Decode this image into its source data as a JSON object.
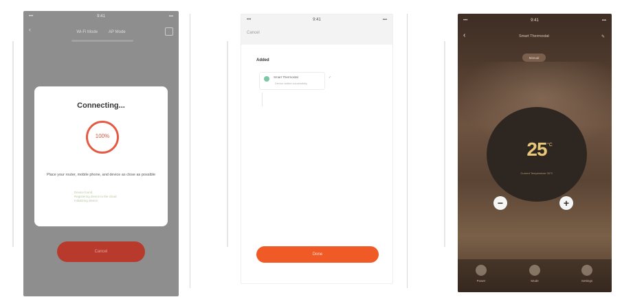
{
  "screen1": {
    "status_left": "•••",
    "status_center": "9:41",
    "status_right": "▪▪▪",
    "header_left": "Wi-Fi Mode",
    "header_right": "AP Mode",
    "back_glyph": "‹",
    "modal_title": "Connecting...",
    "progress_text": "100%",
    "progress_value": 1.0,
    "hint": "Place your router, mobile phone, and device as close as possible",
    "steps": [
      "Device found",
      "Registering device to the cloud",
      "Initializing device"
    ],
    "cancel_label": "Cancel",
    "accent_color": "#e35a45"
  },
  "screen2": {
    "status_left": "•••",
    "status_center": "9:41",
    "status_right": "▪▪▪",
    "cancel_label": "Cancel",
    "section_label": "Added",
    "device_name": "Smart Thermostat",
    "device_status": "Device added successfully",
    "device_check": "✓",
    "done_label": "Done",
    "button_color": "#f05a26"
  },
  "screen3": {
    "status_left": "•••",
    "status_center": "9:41",
    "status_right": "▪▪▪",
    "back_glyph": "‹",
    "title": "Smart Thermostat",
    "edit_glyph": "✎",
    "mode_pill": "Manual",
    "temperature": "25",
    "unit": "°C",
    "dial_status": "Current Temperature 26°C",
    "minus_glyph": "−",
    "plus_glyph": "+",
    "tabs": [
      {
        "label": "Power",
        "icon": "power-icon"
      },
      {
        "label": "Mode",
        "icon": "mode-icon"
      },
      {
        "label": "Settings",
        "icon": "settings-icon"
      }
    ]
  }
}
